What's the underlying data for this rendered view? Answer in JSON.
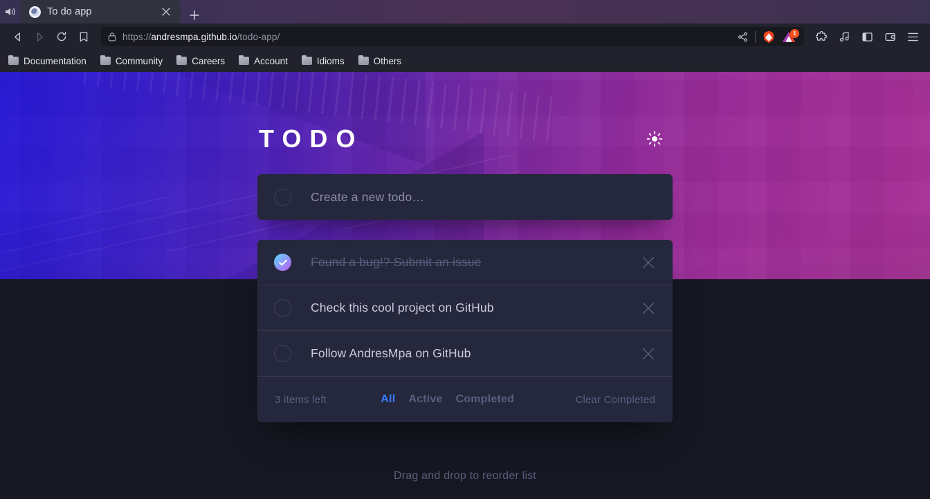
{
  "browser": {
    "tab": {
      "title": "To do app",
      "favicon_icon": "globe-favicon",
      "audio_icon": "speaker-icon",
      "close_icon": "close-icon"
    },
    "new_tab_label": "+",
    "nav": {
      "back_icon": "back-arrow-icon",
      "forward_icon": "forward-arrow-icon",
      "reload_icon": "reload-icon",
      "bookmark_icon": "bookmark-icon"
    },
    "url": {
      "lock_icon": "lock-icon",
      "scheme": "https://",
      "domain": "andresmpa.github.io",
      "path": "/todo-app/",
      "full": "https://andresmpa.github.io/todo-app/",
      "share_icon": "share-icon"
    },
    "toolbar_icons": [
      {
        "name": "brave-lion-icon",
        "badge": ""
      },
      {
        "name": "brave-rewards-triangle-icon",
        "badge": "1"
      },
      {
        "name": "extensions-puzzle-icon",
        "badge": ""
      },
      {
        "name": "music-note-icon",
        "badge": ""
      },
      {
        "name": "sidebar-panel-icon",
        "badge": ""
      },
      {
        "name": "wallet-icon",
        "badge": ""
      },
      {
        "name": "hamburger-menu-icon",
        "badge": ""
      }
    ],
    "bookmarks": [
      {
        "label": "Documentation"
      },
      {
        "label": "Community"
      },
      {
        "label": "Careers"
      },
      {
        "label": "Account"
      },
      {
        "label": "Idioms"
      },
      {
        "label": "Others"
      }
    ]
  },
  "app": {
    "title": "TODO",
    "theme_toggle_icon": "sun-icon",
    "new_todo": {
      "placeholder": "Create a new todo…",
      "value": ""
    },
    "todos": [
      {
        "text": "Found a bug!? Submit an issue",
        "completed": true
      },
      {
        "text": "Check this cool project on GitHub",
        "completed": false
      },
      {
        "text": "Follow AndresMpa on GitHub",
        "completed": false
      }
    ],
    "footer": {
      "items_left": "3 items left",
      "filters": [
        {
          "label": "All",
          "active": true
        },
        {
          "label": "Active",
          "active": false
        },
        {
          "label": "Completed",
          "active": false
        }
      ],
      "clear_completed": "Clear Completed"
    },
    "hint": "Drag and drop to reorder list",
    "colors": {
      "accent_blue": "#3a7cfd",
      "check_gradient_from": "#57ddff",
      "check_gradient_to": "#c058f3",
      "card_bg": "#25273d",
      "page_bg": "#171722"
    }
  }
}
